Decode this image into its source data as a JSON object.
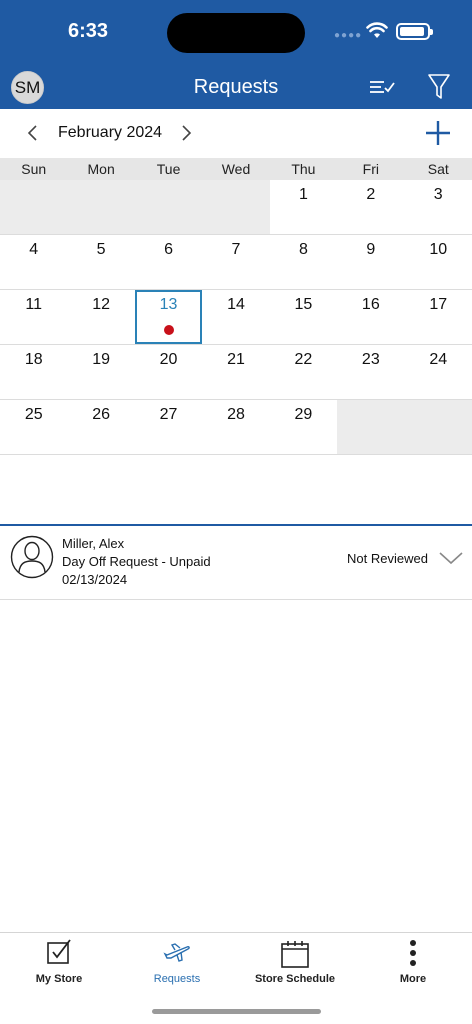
{
  "status_bar": {
    "time": "6:33"
  },
  "header": {
    "avatar_initials": "SM",
    "title": "Requests",
    "icons": [
      "list-check-icon",
      "filter-icon"
    ]
  },
  "month_nav": {
    "label": "February 2024",
    "icons": [
      "chevron-left-icon",
      "chevron-right-icon",
      "plus-icon"
    ]
  },
  "weekdays": [
    "Sun",
    "Mon",
    "Tue",
    "Wed",
    "Thu",
    "Fri",
    "Sat"
  ],
  "calendar": {
    "weeks": [
      [
        "",
        "",
        "",
        "",
        "1",
        "2",
        "3"
      ],
      [
        "4",
        "5",
        "6",
        "7",
        "8",
        "9",
        "10"
      ],
      [
        "11",
        "12",
        "13",
        "14",
        "15",
        "16",
        "17"
      ],
      [
        "18",
        "19",
        "20",
        "21",
        "22",
        "23",
        "24"
      ],
      [
        "25",
        "26",
        "27",
        "28",
        "29",
        "",
        ""
      ]
    ],
    "selected_day": "13",
    "event_days": [
      "13"
    ]
  },
  "request": {
    "name": "Miller, Alex",
    "type": "Day Off Request - Unpaid",
    "date": "02/13/2024",
    "status": "Not Reviewed"
  },
  "tabs": [
    {
      "label": "My Store",
      "icon": "checkbox-icon"
    },
    {
      "label": "Requests",
      "icon": "airplane-icon"
    },
    {
      "label": "Store Schedule",
      "icon": "calendar-icon"
    },
    {
      "label": "More",
      "icon": "more-vertical-icon"
    }
  ],
  "colors": {
    "primary": "#1f5aa3",
    "accent": "#2a82b7",
    "event_dot": "#c8101a",
    "weekday_bg": "#e6e6e6"
  }
}
